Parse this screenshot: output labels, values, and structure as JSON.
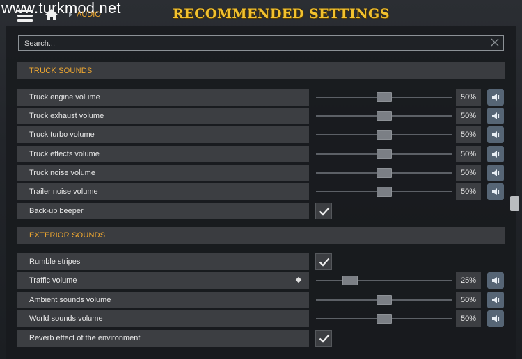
{
  "watermark": "www.turkmod.net",
  "breadcrumb": "AUDIO",
  "title": "RECOMMENDED SETTINGS",
  "search": {
    "placeholder": "Search...",
    "value": ""
  },
  "sections": {
    "truck": "TRUCK SOUNDS",
    "exterior": "EXTERIOR SOUNDS"
  },
  "rows": [
    {
      "label": "Truck engine volume",
      "type": "slider",
      "value": "50%",
      "level": 0.5
    },
    {
      "label": "Truck exhaust volume",
      "type": "slider",
      "value": "50%",
      "level": 0.5
    },
    {
      "label": "Truck turbo volume",
      "type": "slider",
      "value": "50%",
      "level": 0.5
    },
    {
      "label": "Truck effects volume",
      "type": "slider",
      "value": "50%",
      "level": 0.5
    },
    {
      "label": "Truck noise volume",
      "type": "slider",
      "value": "50%",
      "level": 0.5
    },
    {
      "label": "Trailer noise volume",
      "type": "slider",
      "value": "50%",
      "level": 0.5
    },
    {
      "label": "Back-up beeper",
      "type": "checkbox",
      "checked": true
    },
    {
      "label": "Rumble stripes",
      "type": "checkbox",
      "checked": true
    },
    {
      "label": "Traffic volume",
      "type": "slider",
      "value": "25%",
      "level": 0.25
    },
    {
      "label": "Ambient sounds volume",
      "type": "slider",
      "value": "50%",
      "level": 0.5
    },
    {
      "label": "World sounds volume",
      "type": "slider",
      "value": "50%",
      "level": 0.5
    },
    {
      "label": "Reverb effect of the environment",
      "type": "checkbox",
      "checked": true
    }
  ],
  "icons": {
    "menu": "hamburger-menu-icon",
    "home": "home-icon",
    "speaker": "speaker-icon",
    "check": "checkmark-icon",
    "clear": "close-icon"
  },
  "colors": {
    "accent": "#f0a830",
    "title": "#f2c12e",
    "speaker_bg": "#566575"
  }
}
